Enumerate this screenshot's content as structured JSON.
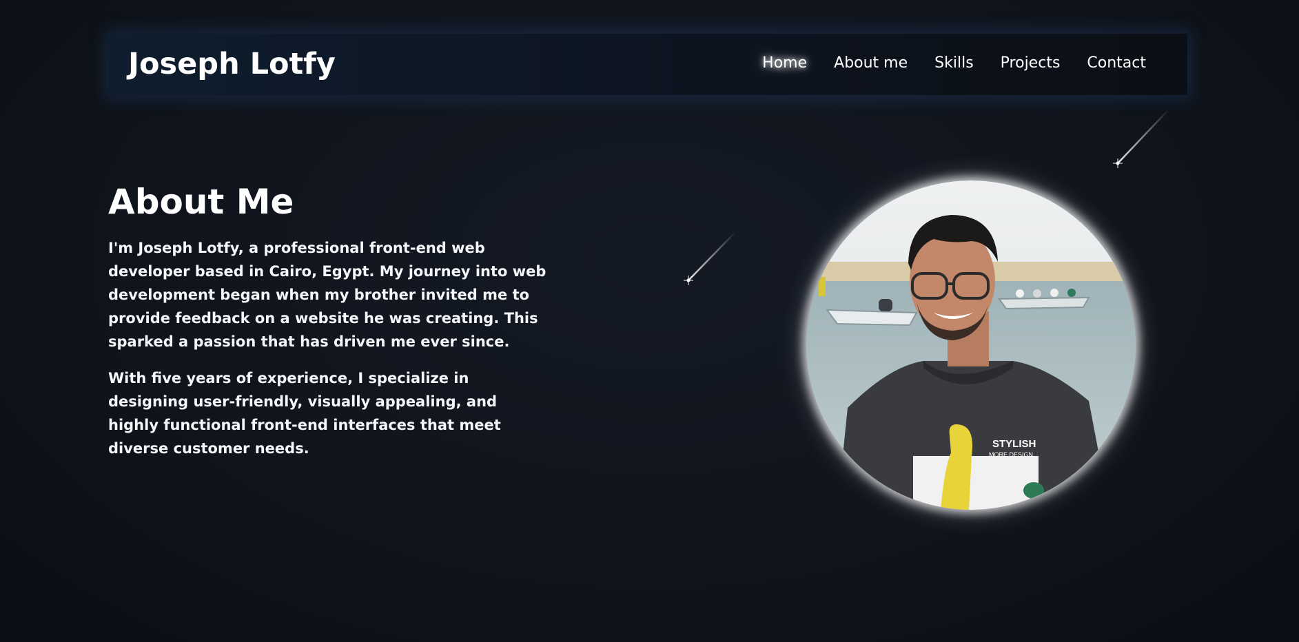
{
  "header": {
    "brand": "Joseph Lotfy",
    "nav": [
      {
        "label": "Home",
        "active": true
      },
      {
        "label": "About me",
        "active": false
      },
      {
        "label": "Skills",
        "active": false
      },
      {
        "label": "Projects",
        "active": false
      },
      {
        "label": "Contact",
        "active": false
      }
    ]
  },
  "about": {
    "title": "About Me",
    "paragraphs": [
      "I'm Joseph Lotfy, a professional front-end web developer based in Cairo, Egypt. My journey into web development began when my brother invited me to provide feedback on a website he was creating. This sparked a passion that has driven me ever since.",
      "With five years of experience, I specialize in designing user-friendly, visually appealing, and highly functional front-end interfaces that meet diverse customer needs."
    ]
  },
  "portrait": {
    "shirt_text_line1": "STYLISH",
    "shirt_text_line2": "MORE DESIGN"
  },
  "colors": {
    "background": "#10141c",
    "navbar_left": "#0f1d2e",
    "navbar_right": "#0c0f15",
    "text": "#ffffff",
    "glow": "#ffffff"
  }
}
